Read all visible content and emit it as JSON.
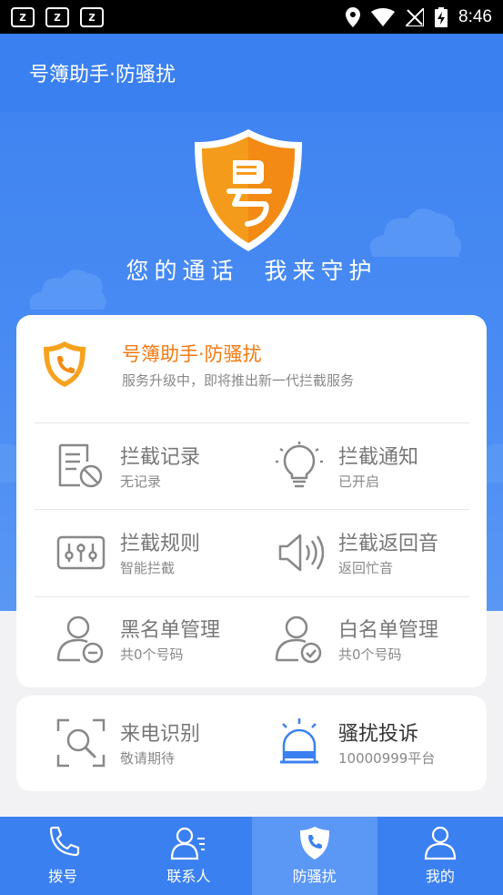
{
  "status_bar": {
    "time": "8:46",
    "notification_letter": "z"
  },
  "app_bar": {
    "title": "号簿助手·防骚扰"
  },
  "hero": {
    "slogan": "您的通话  我来守护"
  },
  "brand": {
    "title": "号簿助手·防骚扰",
    "subtitle": "服务升级中，即将推出新一代拦截服务"
  },
  "grid": [
    {
      "title": "拦截记录",
      "sub": "无记录",
      "icon": "document-block-icon"
    },
    {
      "title": "拦截通知",
      "sub": "已开启",
      "icon": "lightbulb-icon"
    },
    {
      "title": "拦截规则",
      "sub": "智能拦截",
      "icon": "sliders-icon"
    },
    {
      "title": "拦截返回音",
      "sub": "返回忙音",
      "icon": "speaker-icon"
    },
    {
      "title": "黑名单管理",
      "sub": "共0个号码",
      "icon": "user-minus-icon"
    },
    {
      "title": "白名单管理",
      "sub": "共0个号码",
      "icon": "user-check-icon"
    }
  ],
  "services": [
    {
      "title": "来电识别",
      "sub": "敬请期待",
      "icon": "scan-search-icon"
    },
    {
      "title": "骚扰投诉",
      "sub": "10000999平台",
      "icon": "alarm-siren-icon"
    }
  ],
  "tabs": [
    {
      "label": "拨号",
      "icon": "phone-icon"
    },
    {
      "label": "联系人",
      "icon": "contacts-icon"
    },
    {
      "label": "防骚扰",
      "icon": "shield-phone-icon"
    },
    {
      "label": "我的",
      "icon": "profile-icon"
    }
  ],
  "colors": {
    "primary": "#3b80f0",
    "accent": "#f27a12",
    "active_tab": "#5b97f5"
  }
}
